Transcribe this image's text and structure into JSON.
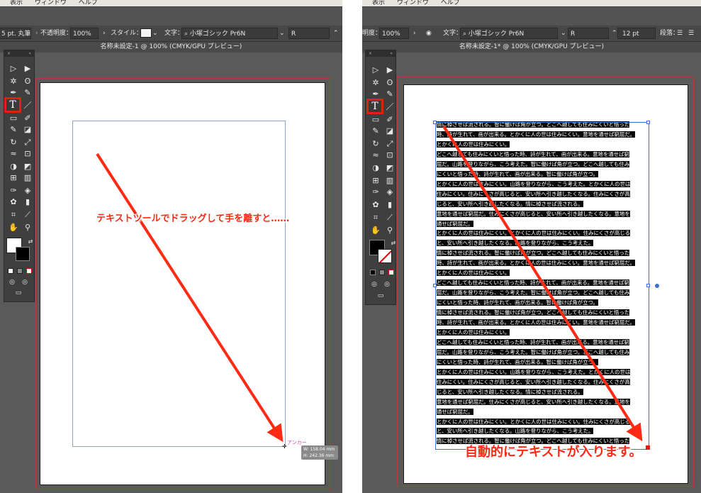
{
  "left": {
    "menu": [
      "表示",
      "ウィンドウ",
      "ヘルプ"
    ],
    "stroke_value": "5 pt. 丸筆",
    "opacity_label": "不透明度：",
    "opacity_value": "100%",
    "style_label": "スタイル：",
    "char_label": "文字：",
    "font_name": "小塚ゴシック Pr6N",
    "font_style": "R",
    "doc_title": "名称未設定-1 @ 100% (CMYK/GPU プレビュー)",
    "callout": "テキストツールでドラッグして手を離すと……",
    "anchor_label": "アンカー",
    "width_readout": "W: 158.04 mm",
    "height_readout": "H: 242.36 mm"
  },
  "right": {
    "menu": [
      "表示",
      "ウィンドウ",
      "ヘルプ"
    ],
    "opacity_label": "明度：",
    "opacity_value": "100%",
    "char_label": "文字：",
    "font_name": "小塚ゴシック Pr6N",
    "font_style": "R",
    "font_size": "12 pt",
    "para_label": "段落：",
    "doc_title": "名称未設定-1* @ 100% (CMYK/GPU プレビュー)",
    "callout": "自動的にテキストが入ります。",
    "text_lines": [
      "情に棹させば流される。智に働けば角が立つ。どこへ越しても住みにくいと悟った",
      "時、詩が生れて、画が出来る。とかくに人の世は住みにくい。意地を通せば窮屈だ。",
      "とかくに人の世は住みにくい。",
      "どこへ越しても住みにくいと悟った時、詩が生れて、画が出来る。意地を通せば窮",
      "屈だ。山路を登りながら、こう考えた。智に働けば角が立つ。どこへ越しても住み",
      "にくいと悟った時、詩が生れて、画が出来る。智に働けば角が立つ。",
      "とかくに人の世は住みにくい。山路を登りながら、こう考えた。とかくに人の世は",
      "住みにくい。住みにくさが高じると、安い所へ引き越したくなる。住みにくさが高",
      "じると、安い所へ引き越したくなる。情に棹させば流される。",
      "意地を通せば窮屈だ。住みにくさが高じると、安い所へ引き越したくなる。意地を",
      "通せば窮屈だ。",
      "とかくに人の世は住みにくい。とかくに人の世は住みにくい。住みにくさが高じる",
      "と、安い所へ引き越したくなる。山路を登りながら、こう考えた。",
      "情に棹させば流される。智に働けば角が立つ。どこへ越しても住みにくいと悟った",
      "時、詩が生れて、画が出来る。とかくに人の世は住みにくい。意地を通せば窮屈だ。",
      "とかくに人の世は住みにくい。",
      "どこへ越しても住みにくいと悟った時、詩が生れて、画が出来る。意地を通せば窮",
      "屈だ。山路を登りながら、こう考えた。智に働けば角が立つ。どこへ越しても住み",
      "にくいと悟った時、詩が生れて、画が出来る。智に働けば角が立つ。",
      "情に棹させば流される。智に働けば角が立つ。どこへ越しても住みにくいと悟った",
      "時、詩が生れて、画が出来る。とかくに人の世は住みにくい。意地を通せば窮屈だ。",
      "とかくに人の世は住みにくい。",
      "どこへ越しても住みにくいと悟った時、詩が生れて、画が出来る。意地を通せば窮",
      "屈だ。山路を登りながら、こう考えた。智に働けば角が立つ。どこへ越しても住み",
      "にくいと悟った時、詩が生れて、画が出来る。智に働けば角が立つ。",
      "とかくに人の世は住みにくい。山路を登りながら、こう考えた。とかくに人の世は",
      "住みにくい。住みにくさが高じると、安い所へ引き越したくなる。住みにくさが高",
      "じると、安い所へ引き越したくなる。情に棹させば流される。",
      "意地を通せば窮屈だ。住みにくさが高じると、安い所へ引き越したくなる。意地を",
      "通せば窮屈だ。",
      "とかくに人の世は住みにくい。とかくに人の世は住みにくい。住みにくさが高じる",
      "と、安い所へ引き越したくなる。山路を登りながら、こう考えた。",
      "情に棹させば流される。智に働けば角が立つ。どこへ越しても住みにくいと悟った"
    ]
  },
  "colors": {
    "accent": "#ff2a14",
    "panel": "#5a5a5a",
    "selection": "#3b6fd1"
  }
}
